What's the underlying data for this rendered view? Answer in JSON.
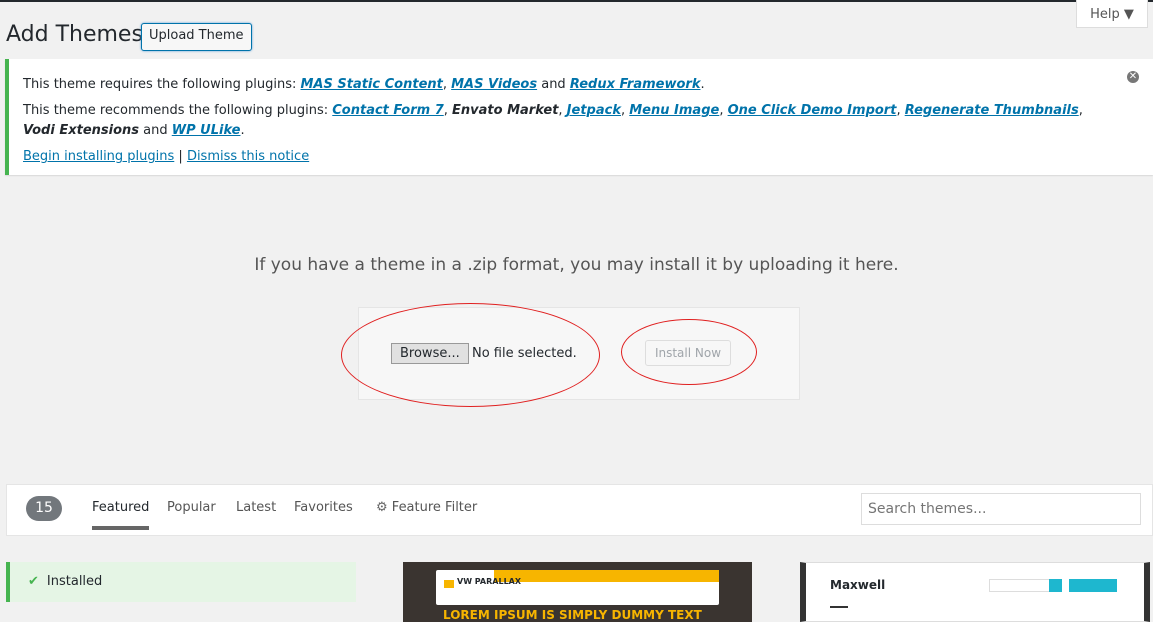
{
  "header": {
    "title": "Add Themes",
    "upload_button": "Upload Theme",
    "help": "Help ▼"
  },
  "notice": {
    "requires_prefix": "This theme requires the following plugins: ",
    "required": [
      "MAS Static Content",
      "MAS Videos",
      "Redux Framework"
    ],
    "recommends_prefix": "This theme recommends the following plugins: ",
    "recommended": [
      {
        "label": "Contact Form 7",
        "link": true
      },
      {
        "label": "Envato Market",
        "link": false
      },
      {
        "label": "Jetpack",
        "link": true
      },
      {
        "label": "Menu Image",
        "link": true
      },
      {
        "label": "One Click Demo Import",
        "link": true
      },
      {
        "label": "Regenerate Thumbnails",
        "link": true
      },
      {
        "label": "Vodi Extensions",
        "link": false
      },
      {
        "label": "WP ULike",
        "link": true
      }
    ],
    "and": " and ",
    "begin": "Begin installing plugins",
    "sep": " | ",
    "dismiss": "Dismiss this notice"
  },
  "upload": {
    "instructions": "If you have a theme in a .zip format, you may install it by uploading it here.",
    "browse": "Browse...",
    "no_file": "No file selected.",
    "install": "Install Now"
  },
  "filter": {
    "count": "15",
    "tabs": [
      "Featured",
      "Popular",
      "Latest",
      "Favorites"
    ],
    "feature_filter": "Feature Filter",
    "search_placeholder": "Search themes..."
  },
  "themes": [
    {
      "status": "Installed"
    },
    {
      "name": "VW PARALLAX",
      "headline": "LOREM IPSUM IS SIMPLY DUMMY TEXT"
    },
    {
      "name": "Maxwell"
    }
  ],
  "colors": {
    "accent": "#0073aa",
    "success": "#46b450",
    "annotation": "#e02020"
  }
}
